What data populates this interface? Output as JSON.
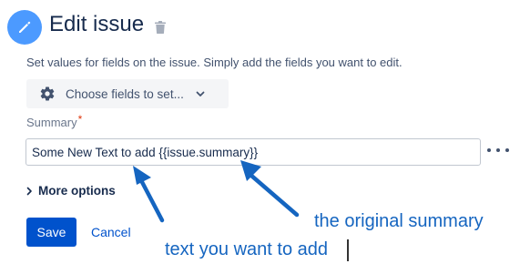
{
  "header": {
    "title": "Edit issue",
    "edit_icon": "pencil-icon",
    "delete_icon": "trash-icon"
  },
  "subtitle": "Set values for fields on the issue. Simply add the fields you want to edit.",
  "choose_fields": {
    "label": "Choose fields to set...",
    "icon": "gear-icon",
    "chevron": "chevron-down-icon"
  },
  "summary": {
    "label": "Summary",
    "required_mark": "*",
    "value": "Some New Text to add {{issue.summary}}"
  },
  "more_options": {
    "label": "More options",
    "icon": "chevron-right-icon"
  },
  "actions": {
    "save_label": "Save",
    "cancel_label": "Cancel"
  },
  "annotations": {
    "original_summary": "the original summary",
    "text_to_add": "text you want to add",
    "color": "#1565c0"
  },
  "colors": {
    "accent": "#4c9aff",
    "primary_button": "#0052cc",
    "required": "#de350b"
  }
}
